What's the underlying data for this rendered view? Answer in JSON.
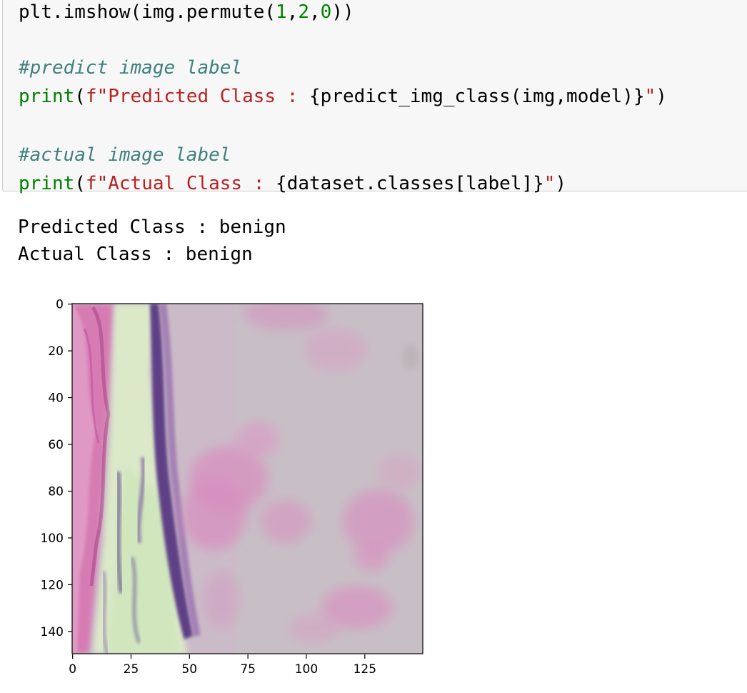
{
  "code_cell": {
    "lines": [
      {
        "tokens": [
          {
            "text": "plt.imshow(img.permute(",
            "kind": "plain"
          },
          {
            "text": "1",
            "kind": "num"
          },
          {
            "text": ",",
            "kind": "plain"
          },
          {
            "text": "2",
            "kind": "num"
          },
          {
            "text": ",",
            "kind": "plain"
          },
          {
            "text": "0",
            "kind": "num"
          },
          {
            "text": "))",
            "kind": "plain"
          }
        ]
      },
      {
        "tokens": []
      },
      {
        "tokens": [
          {
            "text": "#predict image label",
            "kind": "com"
          }
        ]
      },
      {
        "tokens": [
          {
            "text": "print",
            "kind": "kw"
          },
          {
            "text": "(",
            "kind": "plain"
          },
          {
            "text": "f\"Predicted Class : ",
            "kind": "str"
          },
          {
            "text": "{predict_img_class(img,model)}",
            "kind": "plain"
          },
          {
            "text": "\"",
            "kind": "str"
          },
          {
            "text": ")",
            "kind": "plain"
          }
        ]
      },
      {
        "tokens": []
      },
      {
        "tokens": [
          {
            "text": "#actual image label",
            "kind": "com"
          }
        ]
      },
      {
        "tokens": [
          {
            "text": "print",
            "kind": "kw"
          },
          {
            "text": "(",
            "kind": "plain"
          },
          {
            "text": "f\"Actual Class : ",
            "kind": "str"
          },
          {
            "text": "{dataset.classes[label]}",
            "kind": "plain"
          },
          {
            "text": "\"",
            "kind": "str"
          },
          {
            "text": ")",
            "kind": "plain"
          }
        ]
      }
    ]
  },
  "output": {
    "predicted_line": "Predicted Class : benign",
    "actual_line": "Actual Class : benign"
  },
  "plot": {
    "y_ticks": [
      "0",
      "20",
      "40",
      "60",
      "80",
      "100",
      "120",
      "140"
    ],
    "x_ticks": [
      "0",
      "25",
      "50",
      "75",
      "100",
      "125"
    ],
    "image_content": "histology-tissue-patch",
    "colors": {
      "tissue_background": "#c9b8c6",
      "pink_stain": "#d98fc0",
      "purple_nuclei": "#6b4a8c",
      "green_tint": "#d6e8c6"
    }
  }
}
